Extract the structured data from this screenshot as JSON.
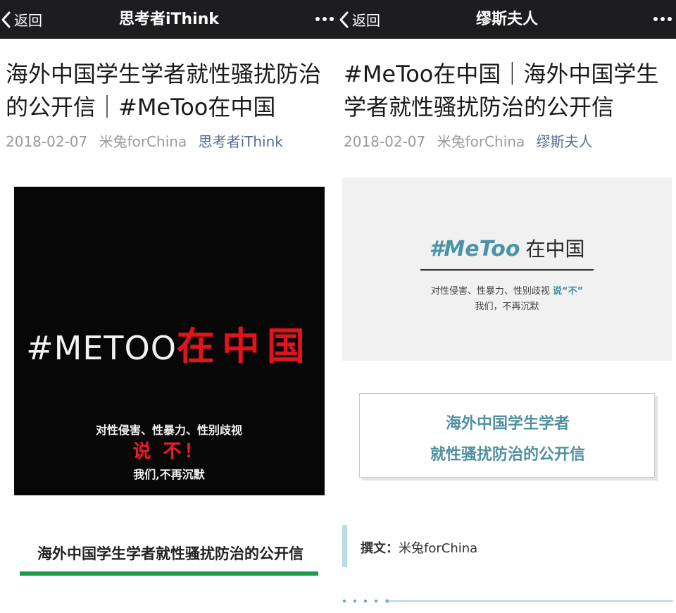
{
  "left": {
    "nav": {
      "back_label": "返回",
      "title": "思考者iThink"
    },
    "article": {
      "title": "海外中国学生学者就性骚扰防治的公开信｜#MeToo在中国",
      "date": "2018-02-07",
      "author": "米兔forChina",
      "account": "思考者iThink"
    },
    "cover": {
      "tag": "#METOO",
      "tag_cn": "在中国",
      "line1": "对性侵害、性暴力、性别歧视",
      "line2": "说 不！",
      "line3": "我们,不再沉默"
    },
    "section_heading": "海外中国学生学者就性骚扰防治的公开信",
    "colors": {
      "accent_green": "#1c9c4a",
      "cover_red": "#e0141b"
    }
  },
  "right": {
    "nav": {
      "back_label": "返回",
      "title": "缪斯夫人"
    },
    "article": {
      "title": "#MeToo在中国｜海外中国学生学者就性骚扰防治的公开信",
      "date": "2018-02-07",
      "author": "米兔forChina",
      "account": "缪斯夫人"
    },
    "cover": {
      "tag": "#MeToo",
      "tag_cn": "在中国",
      "line1_prefix": "对性侵害、性暴力、性别歧视",
      "line1_emphasis": "说“不”",
      "line2": "我们，不再沉默"
    },
    "card": {
      "line1": "海外中国学生学者",
      "line2": "就性骚扰防治的公开信"
    },
    "byline": {
      "label": "撰文：",
      "name": "米兔forChina"
    },
    "colors": {
      "accent_teal": "#4f8fa1"
    }
  },
  "icons": {
    "back": "chevron-left-icon",
    "more": "more-horizontal-icon"
  }
}
